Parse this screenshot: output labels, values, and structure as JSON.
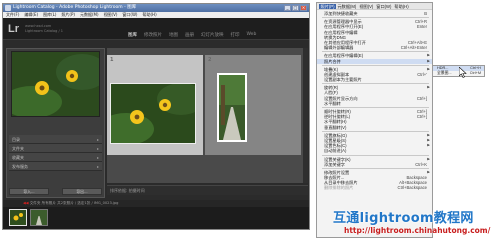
{
  "window": {
    "title": "Lightroom Catalog - Adobe Photoshop Lightroom - 图库",
    "menu_items": [
      "文件(F)",
      "编辑(E)",
      "图库(L)",
      "照片(P)",
      "元数据(M)",
      "视图(V)",
      "窗口(W)",
      "帮助(H)"
    ],
    "minimize": "_",
    "maximize": "□",
    "close": "×"
  },
  "identity_plate": {
    "logo": "Lr",
    "catalog_lines": [
      "www.hxsd.com",
      "Lightroom Catalog / 1"
    ]
  },
  "modules": [
    {
      "label": "图库",
      "active": true
    },
    {
      "label": "修改照片",
      "active": false
    },
    {
      "label": "地图",
      "active": false
    },
    {
      "label": "画册",
      "active": false
    },
    {
      "label": "幻灯片放映",
      "active": false
    },
    {
      "label": "打印",
      "active": false
    },
    {
      "label": "Web",
      "active": false
    }
  ],
  "left_panel": {
    "sections": [
      "目录",
      "文件夹",
      "收藏夹",
      "发布服务"
    ],
    "buttons": [
      "导入...",
      "导出..."
    ]
  },
  "grid": {
    "cells": [
      {
        "index": "1"
      },
      {
        "index": "2"
      }
    ]
  },
  "toolbar": {
    "label": "排序依据: 拍摄时间"
  },
  "filmstrip": {
    "header": "文件夹 所有照片 共2张照片 / 选定1张 / IMG_0023.jpg",
    "arrow": "◀◀"
  },
  "photo_menu": {
    "bar": [
      {
        "label": "照片(P)",
        "active": true
      },
      {
        "label": "元数据(M)",
        "active": false
      },
      {
        "label": "视图(V)",
        "active": false
      },
      {
        "label": "窗口(W)",
        "active": false
      },
      {
        "label": "帮助(H)",
        "active": false
      }
    ],
    "items": [
      {
        "label": "添加到快捷收藏夹",
        "shortcut": "B"
      },
      {
        "type": "sep"
      },
      {
        "label": "在资源管理器中显示",
        "shortcut": "Ctrl+R"
      },
      {
        "label": "在应用程序中打开(E)",
        "shortcut": "Enter"
      },
      {
        "label": "在应用程序中编辑",
        "shortcut": ""
      },
      {
        "label": "转换为DNG",
        "shortcut": ""
      },
      {
        "label": "在其他应用程序中打开",
        "shortcut": "Ctrl+Alt+E"
      },
      {
        "label": "编辑外部编辑器",
        "shortcut": "Ctrl+Alt+Enter"
      },
      {
        "type": "sep"
      },
      {
        "label": "在应用程序中编辑(E)",
        "submenu": true
      },
      {
        "label": "照片合并",
        "submenu": true,
        "highlight": true
      },
      {
        "type": "sep"
      },
      {
        "label": "堆叠(K)",
        "submenu": true
      },
      {
        "label": "创建虚拟副本",
        "shortcut": "Ctrl+'"
      },
      {
        "label": "设置副本为主要照片",
        "shortcut": ""
      },
      {
        "type": "sep"
      },
      {
        "label": "旋转(R)",
        "submenu": true
      },
      {
        "label": "人脸(F)",
        "shortcut": ""
      },
      {
        "label": "设置照片显示方向",
        "shortcut": "Ctrl+]"
      },
      {
        "label": "水平翻转",
        "shortcut": ""
      },
      {
        "type": "sep"
      },
      {
        "label": "顺时针旋转(R)",
        "shortcut": "Ctrl+]"
      },
      {
        "label": "逆时针旋转(L)",
        "shortcut": "Ctrl+["
      },
      {
        "label": "水平翻转(H)",
        "shortcut": ""
      },
      {
        "label": "垂直翻转(V)",
        "shortcut": ""
      },
      {
        "type": "sep"
      },
      {
        "label": "设置旗标(G)",
        "submenu": true
      },
      {
        "label": "设置星级(S)",
        "submenu": true
      },
      {
        "label": "设置色标(C)",
        "submenu": true
      },
      {
        "label": "自动前进(A)",
        "shortcut": ""
      },
      {
        "type": "sep"
      },
      {
        "label": "设置关键字(K)",
        "submenu": true
      },
      {
        "label": "添加关键字",
        "shortcut": "Ctrl+K"
      },
      {
        "type": "sep"
      },
      {
        "label": "修改照片设置",
        "submenu": true
      },
      {
        "label": "移去照片...",
        "shortcut": "Backspace"
      },
      {
        "label": "从目录中移去照片",
        "shortcut": "Alt+Backspace"
      },
      {
        "label": "删除排除的照片",
        "shortcut": "Ctrl+Backspace",
        "disabled": true
      }
    ]
  },
  "submenu": {
    "items": [
      {
        "label": "HDR...",
        "shortcut": "Ctrl+H"
      },
      {
        "label": "全景图...",
        "shortcut": "Ctrl+M"
      }
    ]
  },
  "watermark": {
    "line1": "互通lightroom教程网",
    "line2": "http://lightroom.chinahutong.com/"
  },
  "colors": {
    "accent": "#3a62a8",
    "highlight": "#cfdcf2",
    "watermark_blue": "#2277c8",
    "watermark_red": "#c81e1e"
  }
}
